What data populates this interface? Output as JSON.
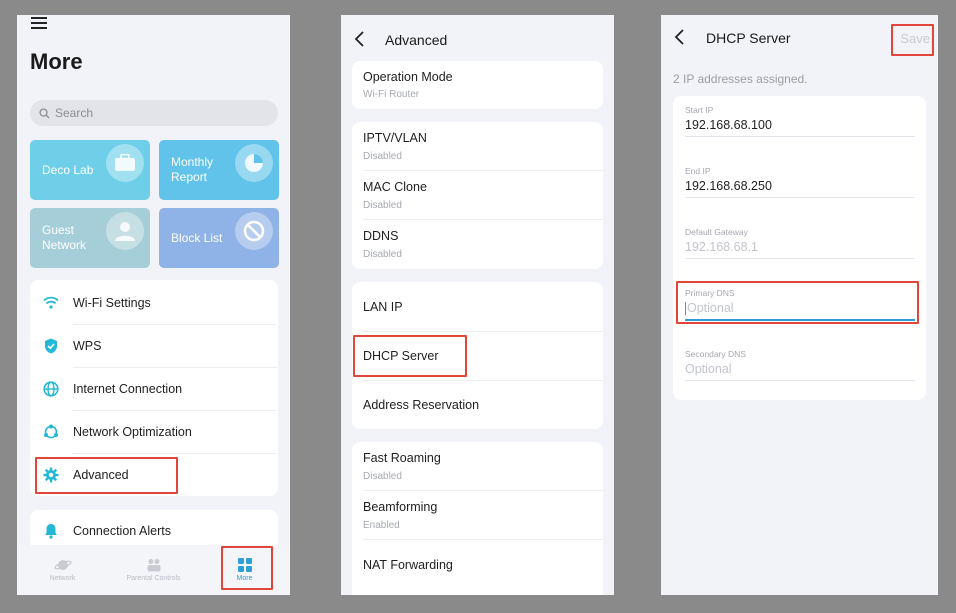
{
  "screen1": {
    "title": "More",
    "search_placeholder": "Search",
    "tiles": [
      {
        "label": "Deco Lab",
        "icon": "toolbox-icon",
        "color": "#6fcfe8"
      },
      {
        "label": "Monthly\nReport",
        "icon": "pie-chart-icon",
        "color": "#62c3ea"
      },
      {
        "label": "Guest\nNetwork",
        "icon": "users-icon",
        "color": "#a6ced8"
      },
      {
        "label": "Block List",
        "icon": "block-icon",
        "color": "#8fb3e6"
      }
    ],
    "menu": [
      {
        "label": "Wi-Fi Settings",
        "icon": "wifi-icon"
      },
      {
        "label": "WPS",
        "icon": "shield-icon"
      },
      {
        "label": "Internet Connection",
        "icon": "globe-icon"
      },
      {
        "label": "Network Optimization",
        "icon": "network-optimization-icon"
      },
      {
        "label": "Advanced",
        "icon": "gear-icon"
      }
    ],
    "alerts_label": "Connection Alerts",
    "tabs": [
      {
        "label": "Network",
        "icon": "planet-icon",
        "active": false
      },
      {
        "label": "Parental Controls",
        "icon": "family-icon",
        "active": false
      },
      {
        "label": "More",
        "icon": "grid-icon",
        "active": true
      }
    ]
  },
  "screen2": {
    "title": "Advanced",
    "group1": [
      {
        "title": "Operation Mode",
        "sub": "Wi-Fi Router"
      }
    ],
    "group2": [
      {
        "title": "IPTV/VLAN",
        "sub": "Disabled"
      },
      {
        "title": "MAC Clone",
        "sub": "Disabled"
      },
      {
        "title": "DDNS",
        "sub": "Disabled"
      }
    ],
    "group3": [
      {
        "title": "LAN IP"
      },
      {
        "title": "DHCP Server"
      },
      {
        "title": "Address Reservation"
      }
    ],
    "group4": [
      {
        "title": "Fast Roaming",
        "sub": "Disabled"
      },
      {
        "title": "Beamforming",
        "sub": "Enabled"
      },
      {
        "title": "NAT Forwarding"
      }
    ]
  },
  "screen3": {
    "title": "DHCP Server",
    "save_label": "Save",
    "assigned_text": "2 IP addresses assigned.",
    "fields": [
      {
        "label": "Start IP",
        "value": "192.168.68.100",
        "muted": false
      },
      {
        "label": "End IP",
        "value": "192.168.68.250",
        "muted": false
      },
      {
        "label": "Default Gateway",
        "value": "192.168.68.1",
        "muted": true
      },
      {
        "label": "Primary DNS",
        "placeholder": "Optional",
        "muted": true
      },
      {
        "label": "Secondary DNS",
        "placeholder": "Optional",
        "muted": true
      }
    ]
  },
  "colors": {
    "accent": "#2a9fd8",
    "highlight": "#e2453a",
    "icon_cyan": "#23b8d6"
  }
}
